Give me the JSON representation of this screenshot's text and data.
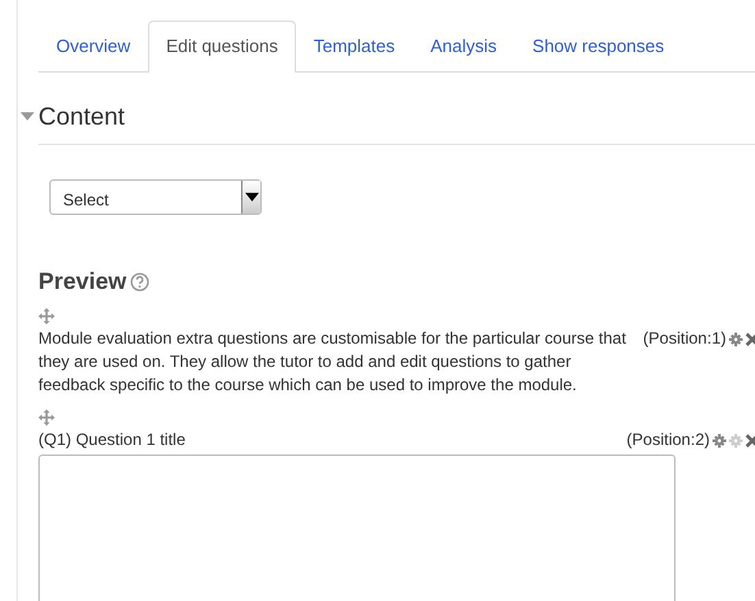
{
  "tabs": [
    {
      "label": "Overview",
      "selected": false
    },
    {
      "label": "Edit questions",
      "selected": true
    },
    {
      "label": "Templates",
      "selected": false
    },
    {
      "label": "Analysis",
      "selected": false
    },
    {
      "label": "Show responses",
      "selected": false
    }
  ],
  "section": {
    "title": "Content",
    "expanded": true
  },
  "select": {
    "value": "Select"
  },
  "preview": {
    "title": "Preview"
  },
  "items": [
    {
      "kind": "label",
      "text": "Module evaluation extra questions are customisable for the particular course that they are used on. They allow the tutor to add and edit questions to gather feedback specific to the course which can be used to improve the module.",
      "position": "(Position:1)",
      "actions": [
        {
          "kind": "edit"
        },
        {
          "kind": "delete"
        }
      ]
    },
    {
      "kind": "textarea",
      "text": "(Q1) Question 1 title",
      "position": "(Position:2)",
      "actions": [
        {
          "kind": "edit"
        },
        {
          "kind": "required"
        },
        {
          "kind": "delete"
        }
      ]
    }
  ]
}
